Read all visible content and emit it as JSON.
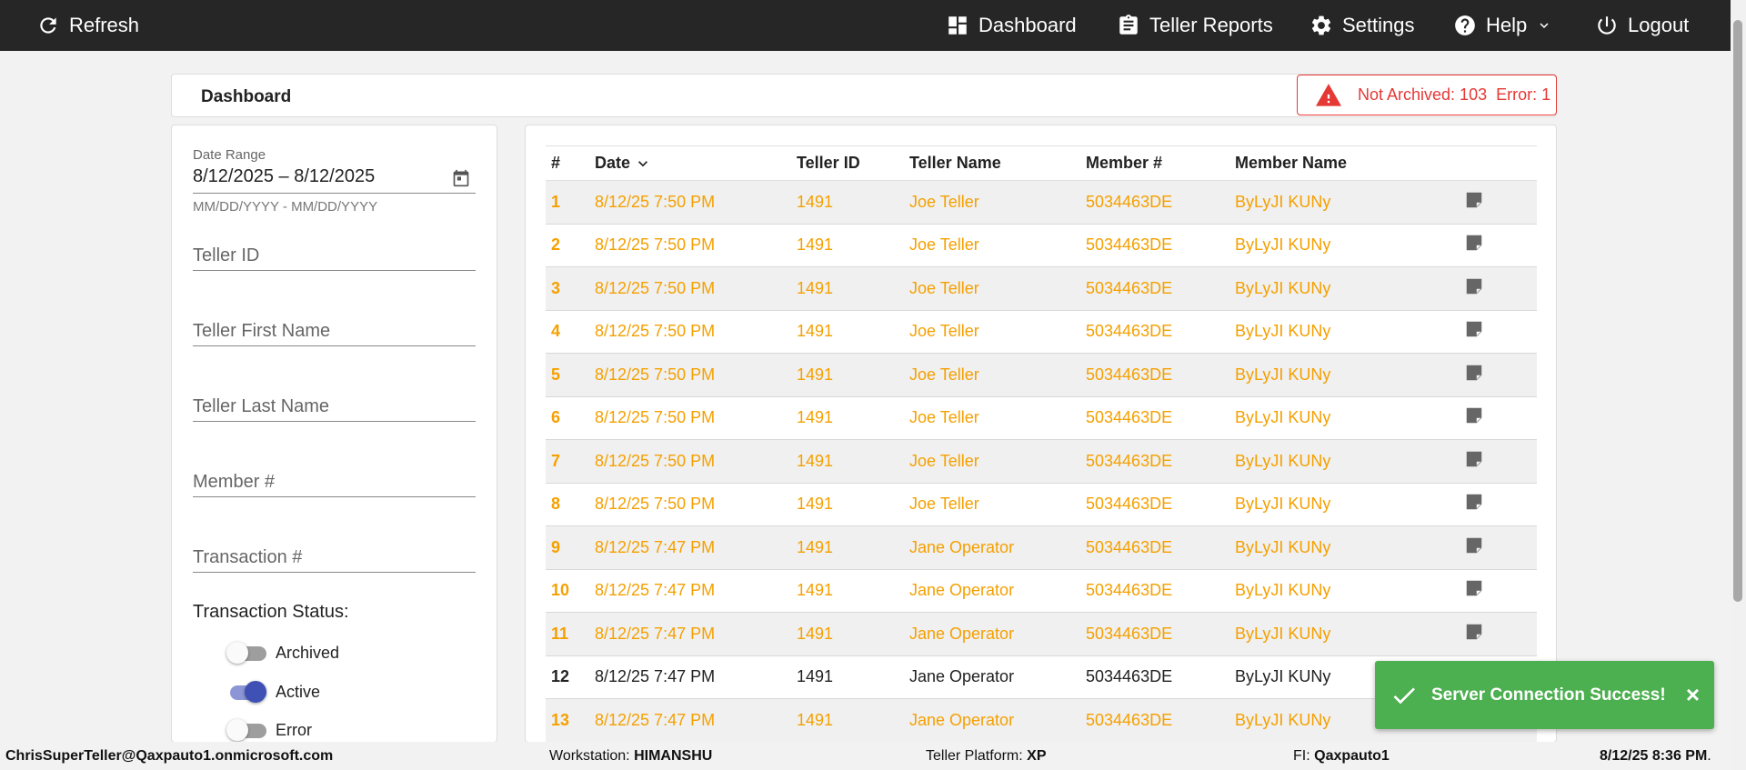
{
  "nav": {
    "refresh": "Refresh",
    "dashboard": "Dashboard",
    "teller_reports": "Teller Reports",
    "settings": "Settings",
    "help": "Help",
    "logout": "Logout"
  },
  "page": {
    "title": "Dashboard"
  },
  "alert": {
    "not_archived": "Not Archived: 103",
    "error": "Error: 1",
    "color": "#e53935"
  },
  "filters": {
    "date_range_label": "Date Range",
    "date_range_value": "8/12/2025 – 8/12/2025",
    "date_range_hint": "MM/DD/YYYY - MM/DD/YYYY",
    "teller_id": "Teller ID",
    "teller_first_name": "Teller First Name",
    "teller_last_name": "Teller Last Name",
    "member_number": "Member #",
    "transaction_number": "Transaction #",
    "status_title": "Transaction Status:",
    "statuses": [
      {
        "label": "Archived",
        "on": false
      },
      {
        "label": "Active",
        "on": true
      },
      {
        "label": "Error",
        "on": false
      }
    ]
  },
  "table": {
    "headers": [
      "#",
      "Date",
      "Teller ID",
      "Teller Name",
      "Member #",
      "Member Name"
    ],
    "rows": [
      {
        "num": "1",
        "date": "8/12/25 7:50 PM",
        "teller_id": "1491",
        "teller_name": "Joe Teller",
        "member_num": "5034463DE",
        "member_name": "ByLyJI KUNy",
        "status": "orange",
        "note": true
      },
      {
        "num": "2",
        "date": "8/12/25 7:50 PM",
        "teller_id": "1491",
        "teller_name": "Joe Teller",
        "member_num": "5034463DE",
        "member_name": "ByLyJI KUNy",
        "status": "orange",
        "note": true
      },
      {
        "num": "3",
        "date": "8/12/25 7:50 PM",
        "teller_id": "1491",
        "teller_name": "Joe Teller",
        "member_num": "5034463DE",
        "member_name": "ByLyJI KUNy",
        "status": "orange",
        "note": true
      },
      {
        "num": "4",
        "date": "8/12/25 7:50 PM",
        "teller_id": "1491",
        "teller_name": "Joe Teller",
        "member_num": "5034463DE",
        "member_name": "ByLyJI KUNy",
        "status": "orange",
        "note": true
      },
      {
        "num": "5",
        "date": "8/12/25 7:50 PM",
        "teller_id": "1491",
        "teller_name": "Joe Teller",
        "member_num": "5034463DE",
        "member_name": "ByLyJI KUNy",
        "status": "orange",
        "note": true
      },
      {
        "num": "6",
        "date": "8/12/25 7:50 PM",
        "teller_id": "1491",
        "teller_name": "Joe Teller",
        "member_num": "5034463DE",
        "member_name": "ByLyJI KUNy",
        "status": "orange",
        "note": true
      },
      {
        "num": "7",
        "date": "8/12/25 7:50 PM",
        "teller_id": "1491",
        "teller_name": "Joe Teller",
        "member_num": "5034463DE",
        "member_name": "ByLyJI KUNy",
        "status": "orange",
        "note": true
      },
      {
        "num": "8",
        "date": "8/12/25 7:50 PM",
        "teller_id": "1491",
        "teller_name": "Joe Teller",
        "member_num": "5034463DE",
        "member_name": "ByLyJI KUNy",
        "status": "orange",
        "note": true
      },
      {
        "num": "9",
        "date": "8/12/25 7:47 PM",
        "teller_id": "1491",
        "teller_name": "Jane Operator",
        "member_num": "5034463DE",
        "member_name": "ByLyJI KUNy",
        "status": "orange",
        "note": true
      },
      {
        "num": "10",
        "date": "8/12/25 7:47 PM",
        "teller_id": "1491",
        "teller_name": "Jane Operator",
        "member_num": "5034463DE",
        "member_name": "ByLyJI KUNy",
        "status": "orange",
        "note": true
      },
      {
        "num": "11",
        "date": "8/12/25 7:47 PM",
        "teller_id": "1491",
        "teller_name": "Jane Operator",
        "member_num": "5034463DE",
        "member_name": "ByLyJI KUNy",
        "status": "orange",
        "note": true
      },
      {
        "num": "12",
        "date": "8/12/25 7:47 PM",
        "teller_id": "1491",
        "teller_name": "Jane Operator",
        "member_num": "5034463DE",
        "member_name": "ByLyJI KUNy",
        "status": "dark",
        "note": false
      },
      {
        "num": "13",
        "date": "8/12/25 7:47 PM",
        "teller_id": "1491",
        "teller_name": "Jane Operator",
        "member_num": "5034463DE",
        "member_name": "ByLyJI KUNy",
        "status": "orange",
        "note": false
      }
    ]
  },
  "toast": {
    "message": "Server Connection Success!",
    "close": "×",
    "color": "#4caf50"
  },
  "footer": {
    "user": "ChrisSuperTeller@Qaxpauto1.onmicrosoft.com",
    "workstation_label": "Workstation:",
    "workstation": "HIMANSHU",
    "platform_label": "Teller Platform:",
    "platform": "XP",
    "fi_label": "FI:",
    "fi": "Qaxpauto1",
    "datetime": "8/12/25 8:36 PM",
    "datetime_suffix": "."
  },
  "colors": {
    "topbar": "#262626",
    "row_orange": "#f5a000",
    "toggle_active": "#3f51b5"
  }
}
